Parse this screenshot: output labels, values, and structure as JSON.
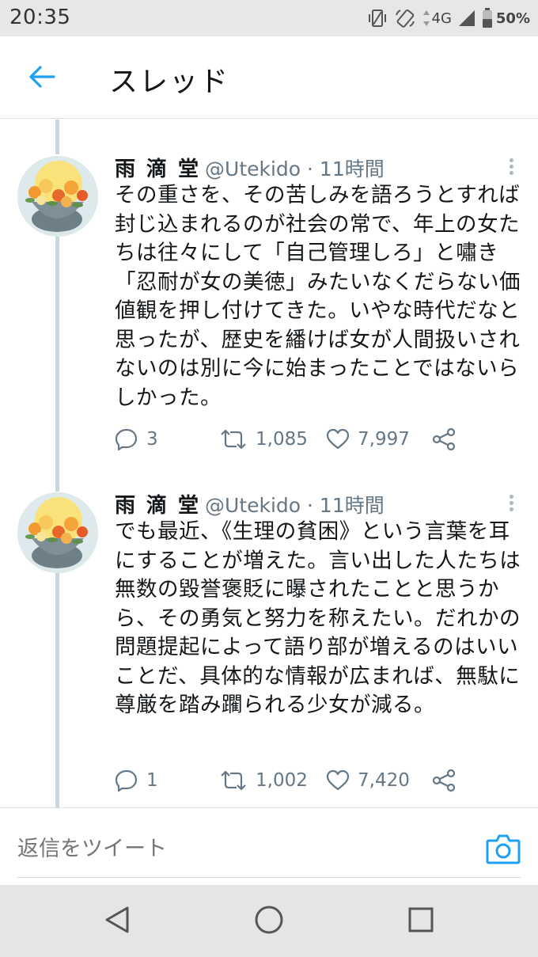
{
  "status_bar": {
    "time": "20:35",
    "network": "4G",
    "battery": "50%",
    "icons": [
      "vibrate-icon",
      "rotate-icon",
      "data-arrows-icon",
      "signal-icon",
      "battery-icon"
    ]
  },
  "header": {
    "title": "スレッド",
    "back_icon": "back-arrow-icon"
  },
  "colors": {
    "accent": "#1da1f2",
    "text": "#14171a",
    "secondary": "#657786",
    "thread_line": "#ccd6dd"
  },
  "tweets": [
    {
      "display_name": "雨滴堂",
      "handle_time": "@Utekido · 11時間",
      "text": "その重さを、その苦しみを語ろうとすれば封じ込まれるのが社会の常で、年上の女たちは往々にして「自己管理しろ」と嘯き「忍耐が女の美徳」みたいなくだらない価値観を押し付けてきた。いやな時代だなと思ったが、歴史を繙けば女が人間扱いされないのは別に今に始まったことではないらしかった。",
      "replies": "3",
      "retweets": "1,085",
      "likes": "7,997"
    },
    {
      "display_name": "雨滴堂",
      "handle_time": "@Utekido · 11時間",
      "text": "でも最近、《生理の貧困》という言葉を耳にすることが増えた。言い出した人たちは無数の毀誉褒貶に曝されたことと思うから、その勇気と努力を称えたい。だれかの問題提起によって語り部が増えるのはいいことだ、具体的な情報が広まれば、無駄に尊厳を踏み躙られる少女が減る。",
      "replies": "1",
      "retweets": "1,002",
      "likes": "7,420"
    }
  ],
  "reply_bar": {
    "placeholder": "返信をツイート",
    "camera_icon": "camera-icon"
  },
  "nav_bar": {
    "icons": [
      "nav-back-icon",
      "nav-home-icon",
      "nav-recents-icon"
    ]
  }
}
